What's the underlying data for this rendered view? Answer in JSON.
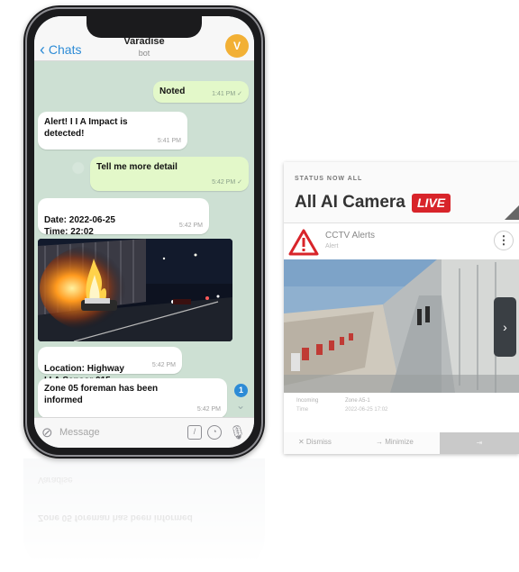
{
  "phone": {
    "header": {
      "back_label": "Chats",
      "name": "Varadise",
      "subtitle": "bot",
      "avatar_letter": "V"
    },
    "messages": [
      {
        "side": "out",
        "text": "Noted",
        "time": "1:41 PM ✓"
      },
      {
        "side": "in",
        "text": "Alert! I I A Impact is detected!",
        "time": "5:41 PM"
      },
      {
        "side": "out",
        "text": "Tell me more detail",
        "time": "5:42 PM ✓"
      },
      {
        "side": "in",
        "text": "Date: 2022-06-25\nTime: 22:02",
        "time": "5:42 PM"
      },
      {
        "side": "in",
        "text": "Location: Highway\nI I A Sensor 015",
        "time": "5:42 PM"
      },
      {
        "side": "in",
        "text": "Zone 05 foreman has been informed",
        "time": "5:42 PM"
      }
    ],
    "unread_badge": "1",
    "input_placeholder": "Message"
  },
  "card": {
    "kicker": "STATUS NOW ALL",
    "title": "All AI Camera",
    "live_label": "LIVE",
    "alert_title": "CCTV Alerts",
    "alert_subtitle": "Alert",
    "meta": {
      "left_1": "Incoming",
      "left_2": "Time",
      "right_1": "Zone A5-1",
      "right_2": "2022-06-25 17:02"
    },
    "actions": [
      "✕  Dismiss",
      "→  Minimize",
      "⇥"
    ]
  },
  "colors": {
    "live_red": "#d8242a",
    "telegram_blue": "#2d8bd6",
    "outgoing_bubble": "#e3f8c9",
    "warning_red": "#d8242a"
  },
  "icons": [
    "chevron-left-icon",
    "paperclip-icon",
    "sticker-icon",
    "clock-icon",
    "microphone-icon",
    "warning-triangle-icon",
    "kebab-menu-icon",
    "chevron-right-icon"
  ]
}
